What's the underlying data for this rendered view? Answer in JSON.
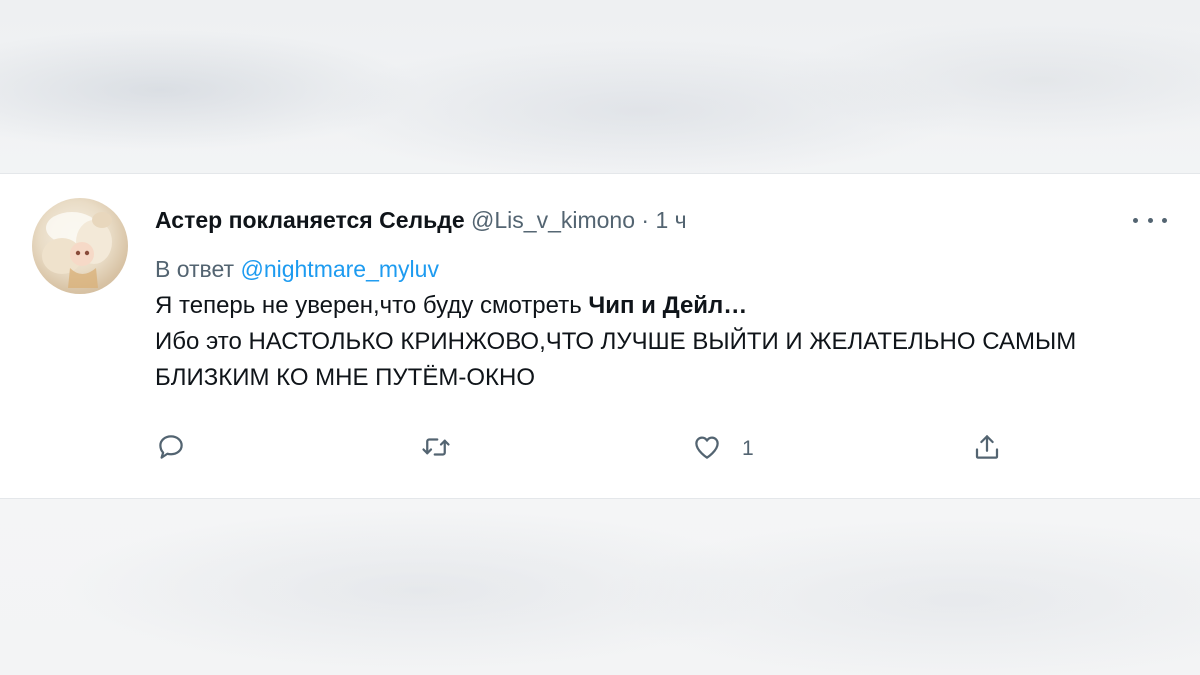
{
  "tweet": {
    "author_name": "Астер покланяется Сельде",
    "handle": "@Lis_v_kimono",
    "separator": "·",
    "time": "1 ч",
    "reply_prefix": "В ответ",
    "reply_to": "@nightmare_myluv",
    "text_line1_plain": "Я теперь не уверен,что буду смотреть ",
    "text_line1_bold": "Чип и Дейл…",
    "text_line2": "Ибо это НАСТОЛЬКО КРИНЖОВО,ЧТО ЛУЧШЕ ВЫЙТИ И ЖЕЛАТЕЛЬНО САМЫМ БЛИЗКИМ КО МНЕ ПУТЁМ-ОКНО",
    "like_count": "1"
  },
  "icons": {
    "more": "more-dots-icon",
    "reply": "speech-bubble-icon",
    "retweet": "retweet-icon",
    "like": "heart-icon",
    "share": "share-upload-icon"
  },
  "colors": {
    "text_primary": "#0f1419",
    "text_secondary": "#536471",
    "link": "#1d9bf0"
  }
}
